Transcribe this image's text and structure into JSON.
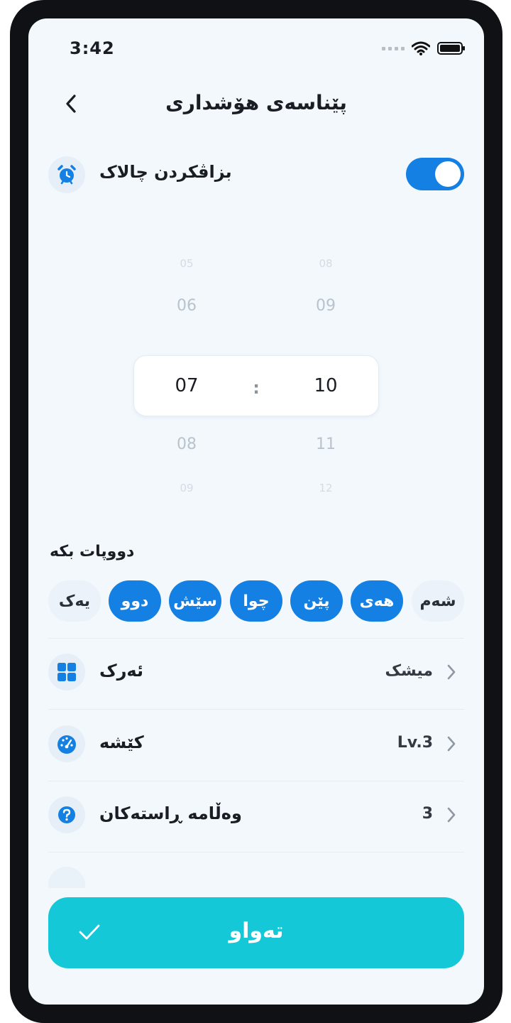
{
  "status_bar": {
    "time": "3:42"
  },
  "header": {
    "title": "پێناسەی هۆشداری"
  },
  "enable_alarm": {
    "label": "بزاڤکردن چالاک",
    "enabled": true
  },
  "time_picker": {
    "separator": ":",
    "hours": {
      "far_above": "05",
      "above": "06",
      "selected": "07",
      "below": "08",
      "far_below": "09"
    },
    "minutes": {
      "far_above": "08",
      "above": "09",
      "selected": "10",
      "below": "11",
      "far_below": "12"
    }
  },
  "repeat": {
    "label": "دووپات بکە",
    "days": [
      {
        "label": "یەک",
        "selected": false
      },
      {
        "label": "دوو",
        "selected": true
      },
      {
        "label": "سێش",
        "selected": true
      },
      {
        "label": "چوا",
        "selected": true
      },
      {
        "label": "پێن",
        "selected": true
      },
      {
        "label": "هەی",
        "selected": true
      },
      {
        "label": "شەم",
        "selected": false
      }
    ]
  },
  "settings": {
    "task": {
      "label": "ئەرک",
      "value": "میشک",
      "icon": "grid-icon"
    },
    "difficulty": {
      "label": "کێشە",
      "value": "Lv.3",
      "icon": "speedometer-icon"
    },
    "correct_answers": {
      "label": "وەڵامە ڕاستەکان",
      "value": "3",
      "icon": "question-icon"
    }
  },
  "done_button": {
    "label": "تەواو"
  },
  "colors": {
    "accent": "#1480e3",
    "done": "#14c8d8",
    "background": "#f3f8fc"
  }
}
